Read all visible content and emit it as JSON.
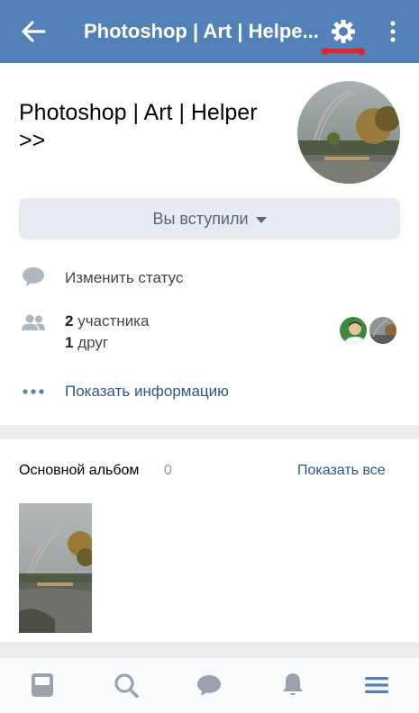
{
  "header": {
    "title": "Photoshop | Art | Helpe...",
    "back_icon": "arrow-left-icon",
    "settings_icon": "gear-icon",
    "more_icon": "more-vertical-icon",
    "bar_color": "#5181b8",
    "highlight_color": "#e5242a"
  },
  "profile": {
    "name": "Photoshop | Art | Helper >>",
    "joined_label": "Вы вступили",
    "status_label": "Изменить статус",
    "members_count": "2",
    "members_text": "участника",
    "friends_count": "1",
    "friends_text": "друг",
    "show_info_label": "Показать информацию",
    "link_color": "#2a5885"
  },
  "album": {
    "title": "Основной альбом",
    "count": "0",
    "show_all_label": "Показать все"
  },
  "bottom_nav": [
    {
      "icon": "news-icon"
    },
    {
      "icon": "search-icon"
    },
    {
      "icon": "messages-icon"
    },
    {
      "icon": "notifications-icon"
    },
    {
      "icon": "menu-icon",
      "active": true
    }
  ]
}
